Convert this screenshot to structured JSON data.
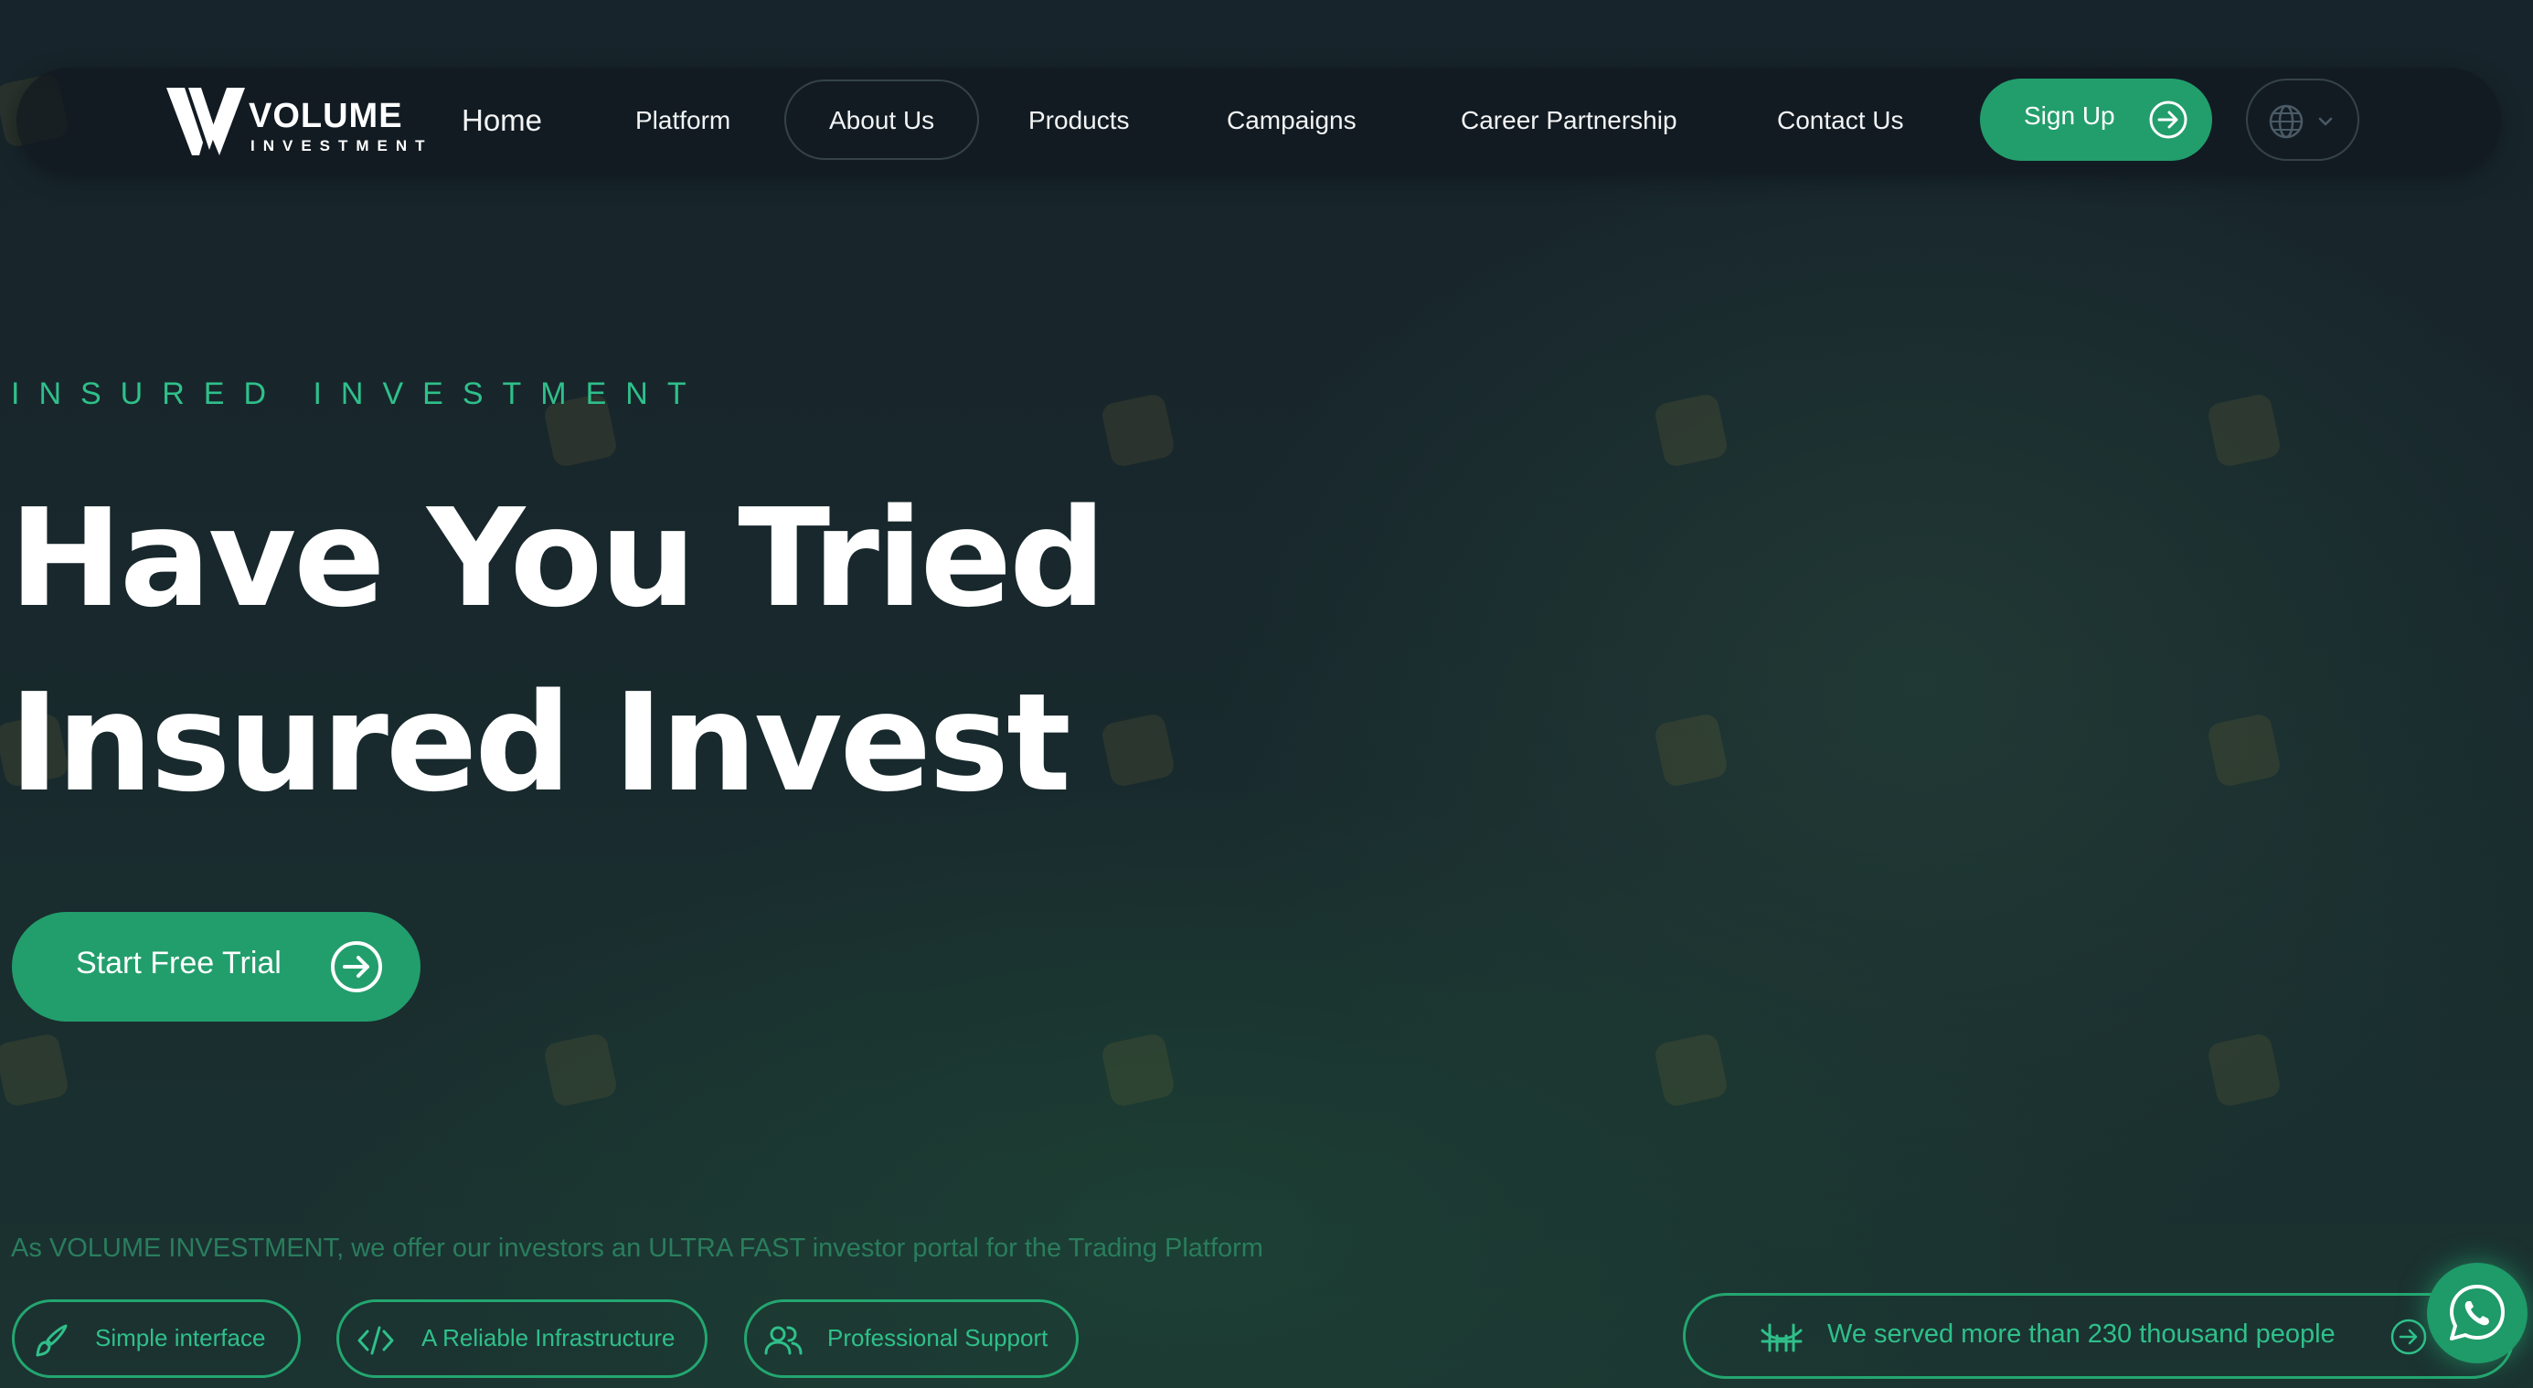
{
  "brand": {
    "name": "VOLUME",
    "subtitle": "INVESTMENT",
    "logo_icon": "volume-v-logo"
  },
  "nav": {
    "items": [
      {
        "label": "Home"
      },
      {
        "label": "Platform"
      },
      {
        "label": "About Us"
      },
      {
        "label": "Products"
      },
      {
        "label": "Campaigns"
      },
      {
        "label": "Career Partnership"
      },
      {
        "label": "Contact Us"
      }
    ],
    "signup_label": "Sign Up",
    "language_icon": "globe-icon"
  },
  "hero": {
    "eyebrow": "INSURED INVESTMENT",
    "title_line1": "Have You Tried",
    "title_line2": "Insured Invest",
    "cta_label": "Start Free Trial",
    "tagline": "As VOLUME INVESTMENT, we offer our investors an ULTRA FAST investor portal for the Trading Platform"
  },
  "features": [
    {
      "label": "Simple interface",
      "icon": "brush-icon"
    },
    {
      "label": "A Reliable Infrastructure",
      "icon": "code-icon"
    },
    {
      "label": "Professional Support",
      "icon": "users-icon"
    }
  ],
  "served": {
    "label": "We served more than 230 thousand people",
    "icon": "bridge-icon"
  },
  "colors": {
    "accent_green": "#229e6c",
    "accent_text": "#2fc08a",
    "background": "#17242b"
  }
}
